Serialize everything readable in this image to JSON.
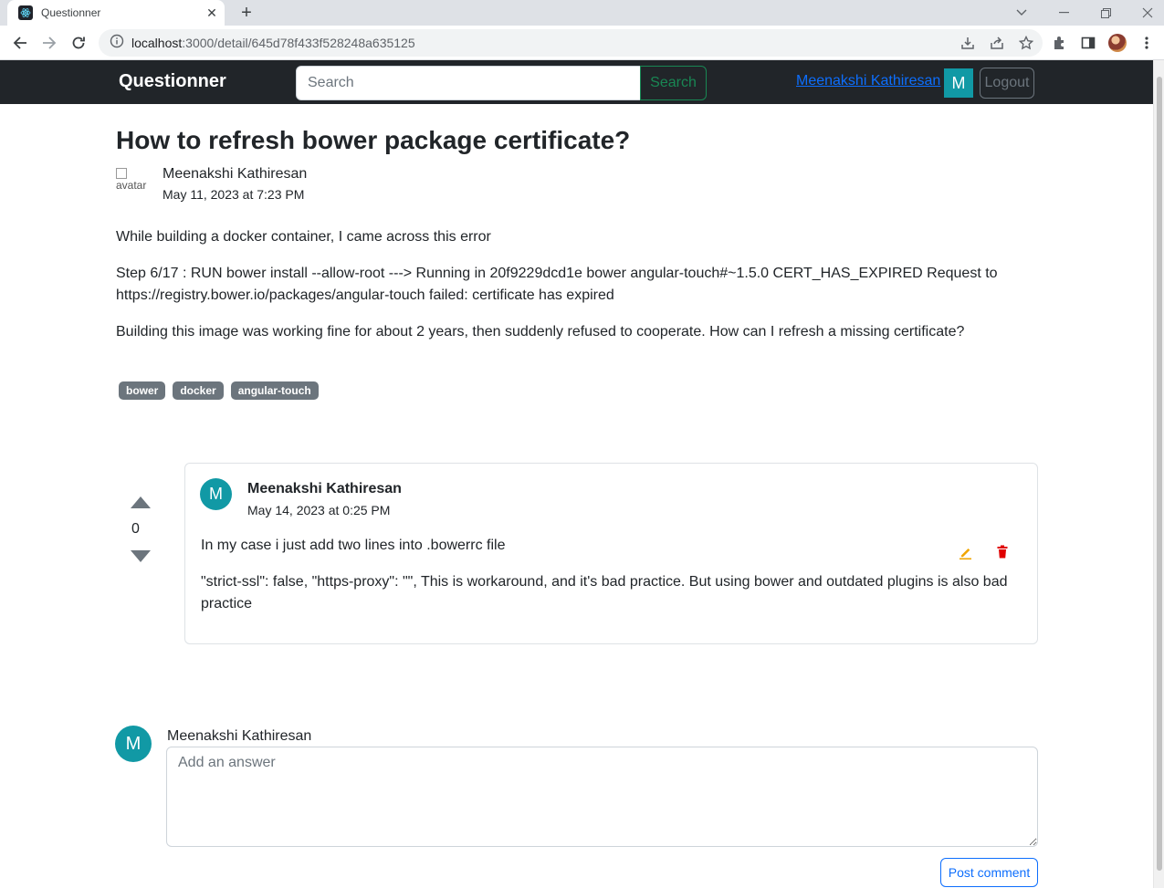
{
  "browser": {
    "tab_title": "Questionner",
    "url_host": "localhost",
    "url_path": ":3000/detail/645d78f433f528248a635125"
  },
  "nav": {
    "brand": "Questionner",
    "search_placeholder": "Search",
    "search_button": "Search",
    "user_name": "Meenakshi Kathiresan",
    "user_initial": "M",
    "logout": "Logout"
  },
  "question": {
    "title": "How to refresh bower package certificate?",
    "avatar_alt": "avatar",
    "author": "Meenakshi Kathiresan",
    "date": "May 11, 2023 at 7:23 PM",
    "paragraphs": [
      "While building a docker container, I came across this error",
      "Step 6/17 : RUN bower install --allow-root ---> Running in 20f9229dcd1e bower angular-touch#~1.5.0 CERT_HAS_EXPIRED Request to https://registry.bower.io/packages/angular-touch failed: certificate has expired",
      "Building this image was working fine for about 2 years, then suddenly refused to cooperate. How can I refresh a missing certificate?"
    ],
    "tags": [
      "bower",
      "docker",
      "angular-touch"
    ]
  },
  "answer": {
    "votes": "0",
    "initial": "M",
    "author": "Meenakshi Kathiresan",
    "date": "May 14, 2023 at 0:25 PM",
    "paragraphs": [
      "In my case i just add two lines into .bowerrc file",
      "\"strict-ssl\": false, \"https-proxy\": \"\", This is workaround, and it's bad practice. But using bower and outdated plugins is also bad practice"
    ]
  },
  "comment_form": {
    "initial": "M",
    "user_name": "Meenakshi Kathiresan",
    "placeholder": "Add an answer",
    "submit": "Post comment"
  },
  "colors": {
    "navbar_bg": "#212529",
    "avatar_teal": "#1199a5",
    "link_blue": "#0d6efd",
    "search_green": "#198754",
    "tag_gray": "#6c757d",
    "edit_orange": "#f0a500",
    "delete_red": "#e00000"
  }
}
